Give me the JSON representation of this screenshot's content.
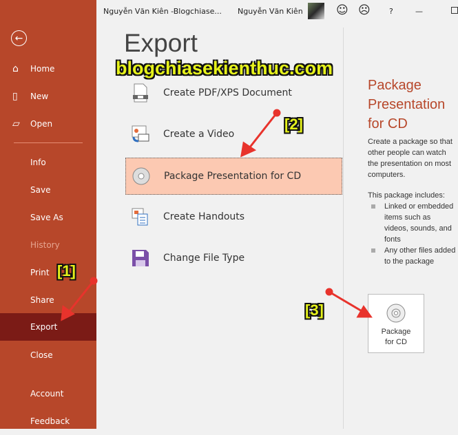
{
  "titlebar": {
    "document": "Nguyễn Văn Kiên -Blogchiase...",
    "user": "Nguyễn Văn Kiên",
    "help": "?",
    "minimize": "—",
    "smile": "☺",
    "frown": "☹"
  },
  "sidebar": {
    "items": [
      {
        "label": "Home",
        "icon": "home-icon",
        "glyph": "⌂"
      },
      {
        "label": "New",
        "icon": "new-document-icon",
        "glyph": "🗋"
      },
      {
        "label": "Open",
        "icon": "open-folder-icon",
        "glyph": "🗁"
      },
      {
        "label": "Info"
      },
      {
        "label": "Save"
      },
      {
        "label": "Save As"
      },
      {
        "label": "History",
        "disabled": true
      },
      {
        "label": "Print"
      },
      {
        "label": "Share"
      },
      {
        "label": "Export",
        "selected": true
      },
      {
        "label": "Close"
      },
      {
        "label": "Account"
      },
      {
        "label": "Feedback"
      }
    ],
    "back_glyph": "←"
  },
  "main": {
    "title": "Export",
    "options": [
      {
        "label": "Create PDF/XPS Document",
        "icon": "pdf-document-icon"
      },
      {
        "label": "Create a Video",
        "icon": "video-icon"
      },
      {
        "label": "Package Presentation for CD",
        "icon": "cd-icon",
        "selected": true
      },
      {
        "label": "Create Handouts",
        "icon": "handouts-icon"
      },
      {
        "label": "Change File Type",
        "icon": "file-type-icon"
      }
    ]
  },
  "detail": {
    "title": "Package Presentation for CD",
    "description": "Create a package so that other people can watch the presentation on most computers.",
    "includes_label": "This package includes:",
    "includes": [
      "Linked or embedded items such as videos, sounds, and fonts",
      "Any other files added to the package"
    ],
    "button_label_1": "Package",
    "button_label_2": "for CD"
  },
  "annotations": {
    "watermark": "blogchiasekienthuc.com",
    "step1": "[1]",
    "step2": "[2]",
    "step3": "[3]",
    "arrow_color": "#e8332c"
  },
  "colors": {
    "accent": "#b7472a",
    "selected_nav": "#7b1b16",
    "selected_option": "#fcc9b2"
  }
}
